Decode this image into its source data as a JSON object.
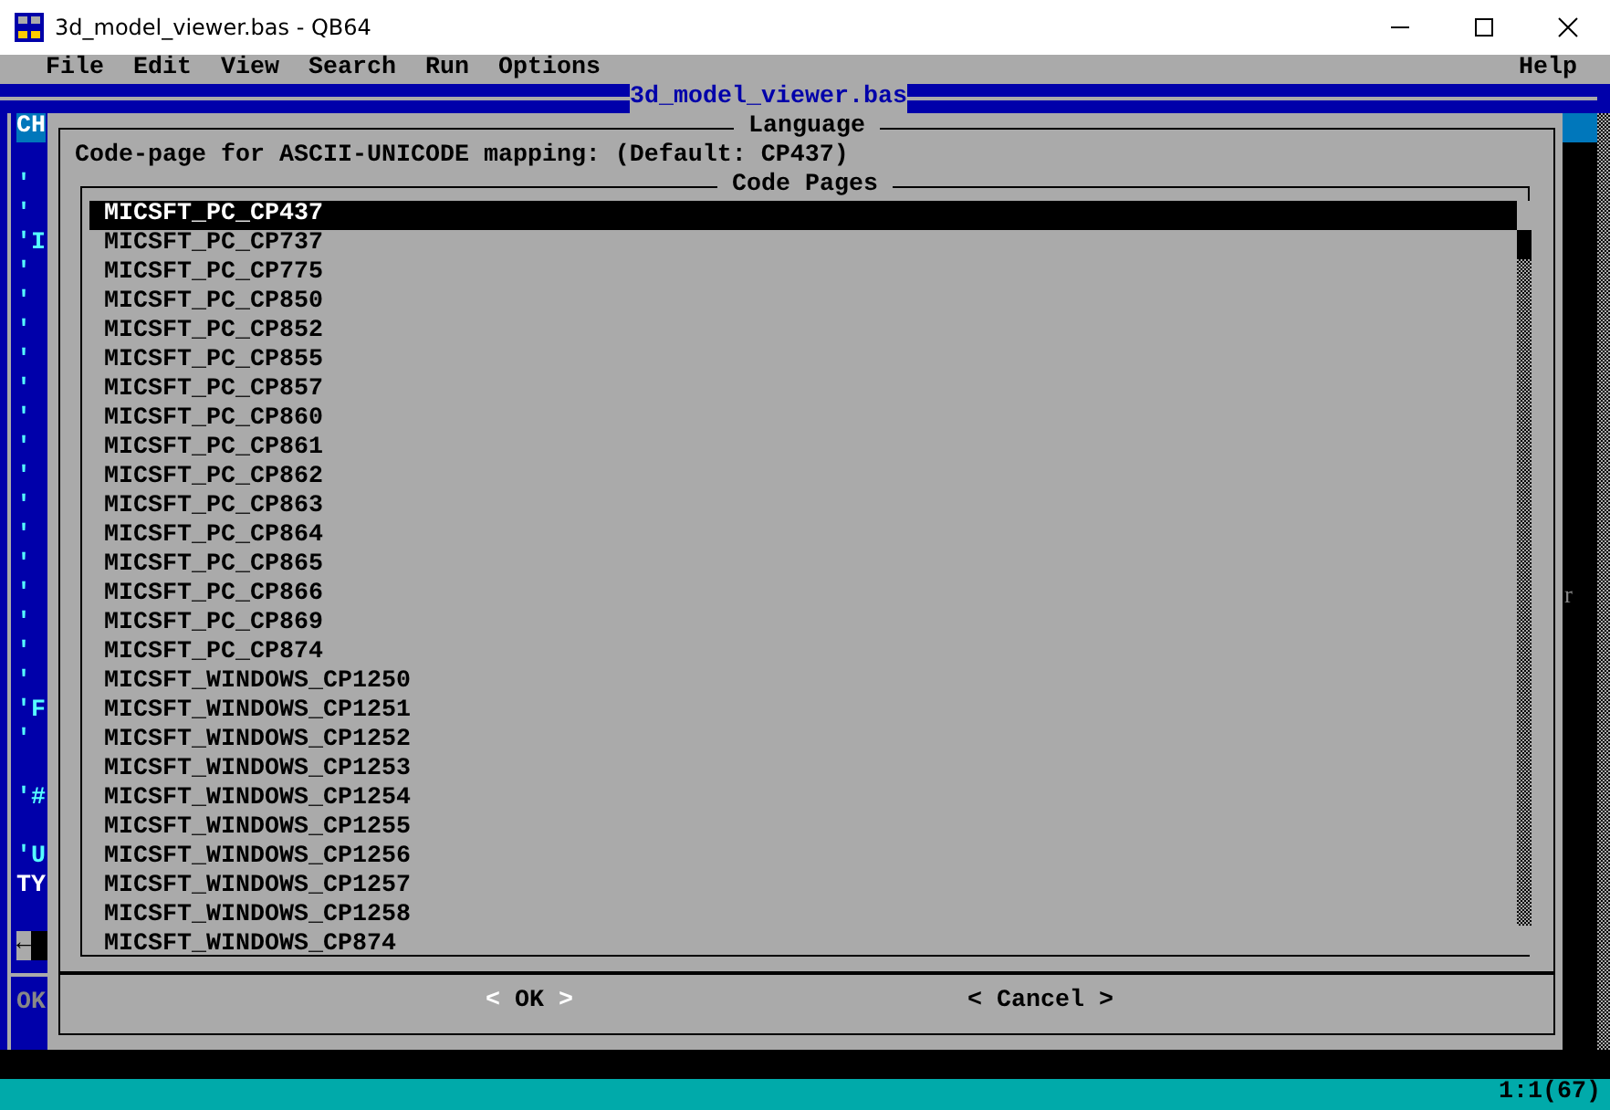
{
  "window": {
    "title": "3d_model_viewer.bas - QB64"
  },
  "menu": [
    {
      "label": "File"
    },
    {
      "label": "Edit"
    },
    {
      "label": "View"
    },
    {
      "label": "Search"
    },
    {
      "label": "Run"
    },
    {
      "label": "Options"
    }
  ],
  "help_menu": {
    "label": "Help"
  },
  "editor": {
    "title": "3d_model_viewer.bas",
    "lines": [
      {
        "kind": "cursor",
        "text": "CH"
      },
      {
        "kind": "blank"
      },
      {
        "kind": "comment",
        "text": "'"
      },
      {
        "kind": "comment",
        "text": "'"
      },
      {
        "kind": "comment",
        "text": "'I"
      },
      {
        "kind": "comment",
        "text": "'"
      },
      {
        "kind": "comment",
        "text": "'"
      },
      {
        "kind": "comment",
        "text": "'"
      },
      {
        "kind": "comment",
        "text": "'"
      },
      {
        "kind": "comment",
        "text": "'"
      },
      {
        "kind": "comment",
        "text": "'"
      },
      {
        "kind": "comment",
        "text": "'"
      },
      {
        "kind": "comment",
        "text": "'"
      },
      {
        "kind": "comment",
        "text": "'"
      },
      {
        "kind": "comment",
        "text": "'"
      },
      {
        "kind": "comment",
        "text": "'"
      },
      {
        "kind": "comment",
        "text": "'"
      },
      {
        "kind": "comment",
        "text": "'"
      },
      {
        "kind": "comment",
        "text": "'"
      },
      {
        "kind": "comment",
        "text": "'"
      },
      {
        "kind": "comment",
        "text": "'F"
      },
      {
        "kind": "comment",
        "text": "'"
      },
      {
        "kind": "blank"
      },
      {
        "kind": "comment",
        "text": "'#"
      },
      {
        "kind": "blank"
      },
      {
        "kind": "comment",
        "text": "'U"
      },
      {
        "kind": "code",
        "text": "TY"
      },
      {
        "kind": "blank"
      },
      {
        "kind": "scroll",
        "text": "←"
      },
      {
        "kind": "rule"
      },
      {
        "kind": "dim",
        "text": "OK"
      }
    ],
    "right_text": "r"
  },
  "dialog": {
    "title": "Language",
    "prompt": "Code-page for ASCII-UNICODE mapping: (Default: CP437)",
    "list": {
      "title": "Code Pages",
      "items": [
        {
          "label": "MICSFT_PC_CP437",
          "selected": true
        },
        {
          "label": "MICSFT_PC_CP737",
          "selected": false
        },
        {
          "label": "MICSFT_PC_CP775",
          "selected": false
        },
        {
          "label": "MICSFT_PC_CP850",
          "selected": false
        },
        {
          "label": "MICSFT_PC_CP852",
          "selected": false
        },
        {
          "label": "MICSFT_PC_CP855",
          "selected": false
        },
        {
          "label": "MICSFT_PC_CP857",
          "selected": false
        },
        {
          "label": "MICSFT_PC_CP860",
          "selected": false
        },
        {
          "label": "MICSFT_PC_CP861",
          "selected": false
        },
        {
          "label": "MICSFT_PC_CP862",
          "selected": false
        },
        {
          "label": "MICSFT_PC_CP863",
          "selected": false
        },
        {
          "label": "MICSFT_PC_CP864",
          "selected": false
        },
        {
          "label": "MICSFT_PC_CP865",
          "selected": false
        },
        {
          "label": "MICSFT_PC_CP866",
          "selected": false
        },
        {
          "label": "MICSFT_PC_CP869",
          "selected": false
        },
        {
          "label": "MICSFT_PC_CP874",
          "selected": false
        },
        {
          "label": "MICSFT_WINDOWS_CP1250",
          "selected": false
        },
        {
          "label": "MICSFT_WINDOWS_CP1251",
          "selected": false
        },
        {
          "label": "MICSFT_WINDOWS_CP1252",
          "selected": false
        },
        {
          "label": "MICSFT_WINDOWS_CP1253",
          "selected": false
        },
        {
          "label": "MICSFT_WINDOWS_CP1254",
          "selected": false
        },
        {
          "label": "MICSFT_WINDOWS_CP1255",
          "selected": false
        },
        {
          "label": "MICSFT_WINDOWS_CP1256",
          "selected": false
        },
        {
          "label": "MICSFT_WINDOWS_CP1257",
          "selected": false
        },
        {
          "label": "MICSFT_WINDOWS_CP1258",
          "selected": false
        },
        {
          "label": "MICSFT_WINDOWS_CP874",
          "selected": false
        }
      ]
    },
    "buttons": [
      {
        "open": "<",
        "label": "OK",
        "close": ">",
        "selected": true
      },
      {
        "open": "<",
        "label": "Cancel",
        "close": ">",
        "selected": false
      }
    ]
  },
  "status_bar": {
    "position": "1:1(67)"
  }
}
